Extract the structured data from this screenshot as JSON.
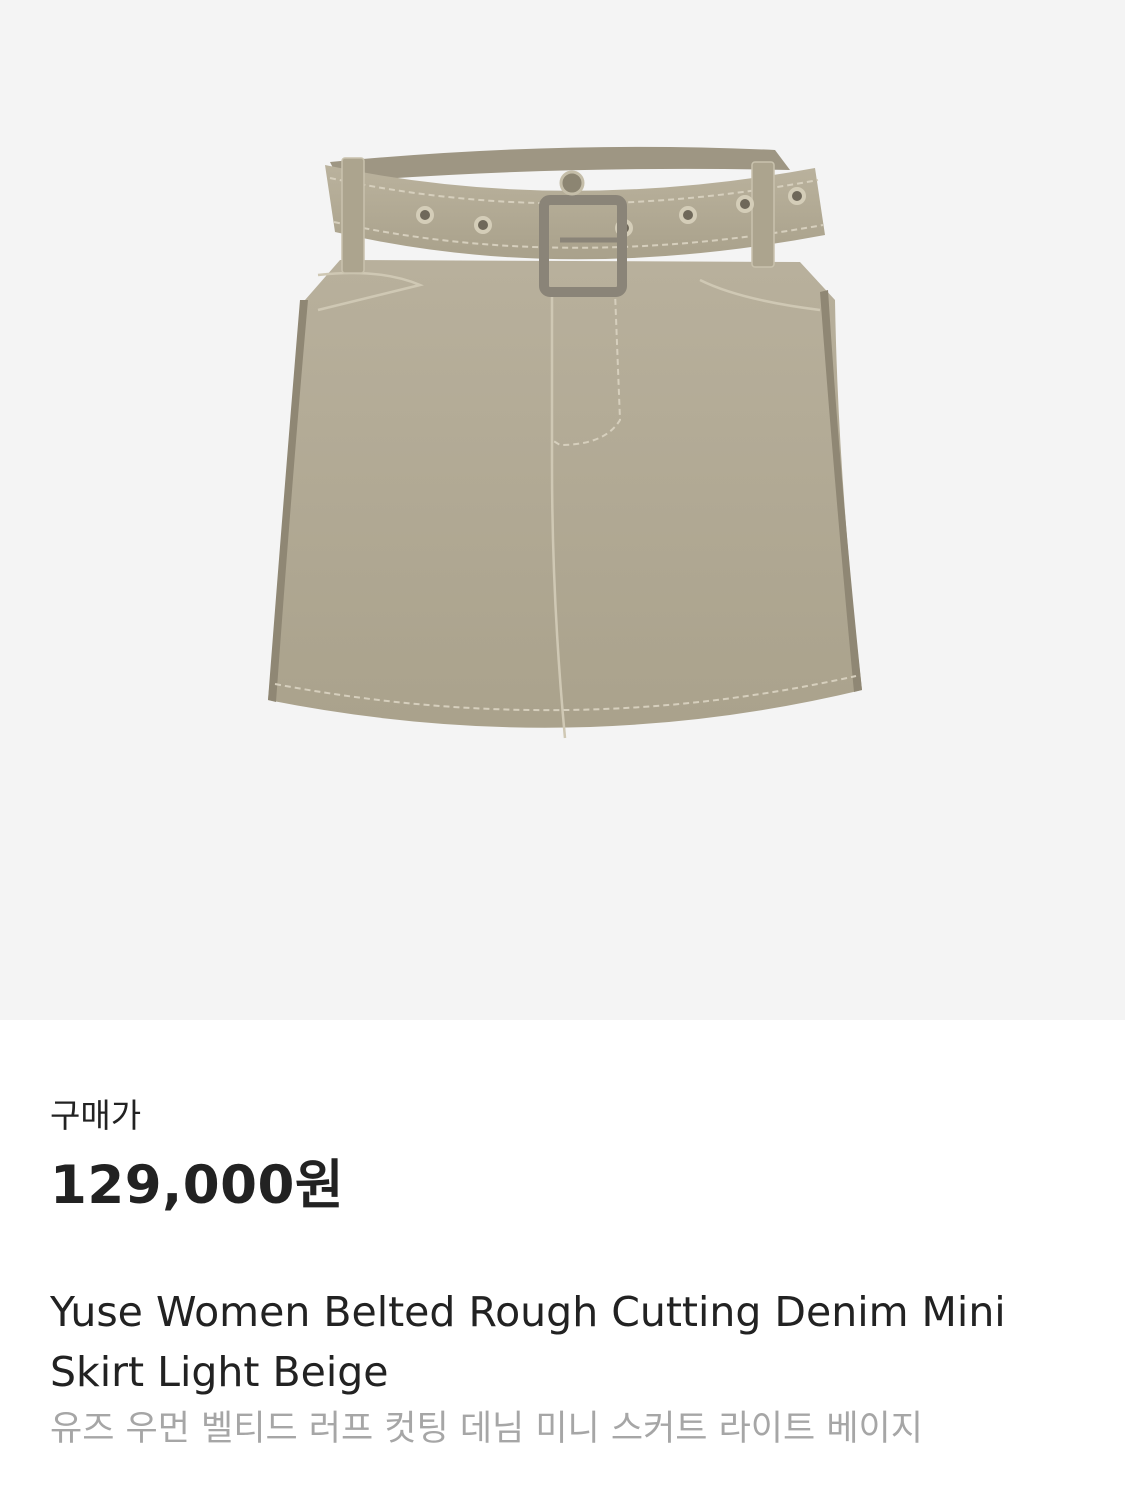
{
  "product": {
    "image_alt": "Belted denim mini skirt, light beige",
    "background_color": "#f4f4f4",
    "fabric_color": "#b3ab98"
  },
  "pricing": {
    "label": "구매가",
    "price": "129,000원"
  },
  "name": {
    "english": "Yuse Women Belted Rough Cutting Denim Mini Skirt Light Beige",
    "korean": "유즈 우먼 벨티드 러프 컷팅 데님 미니 스커트 라이트 베이지"
  }
}
